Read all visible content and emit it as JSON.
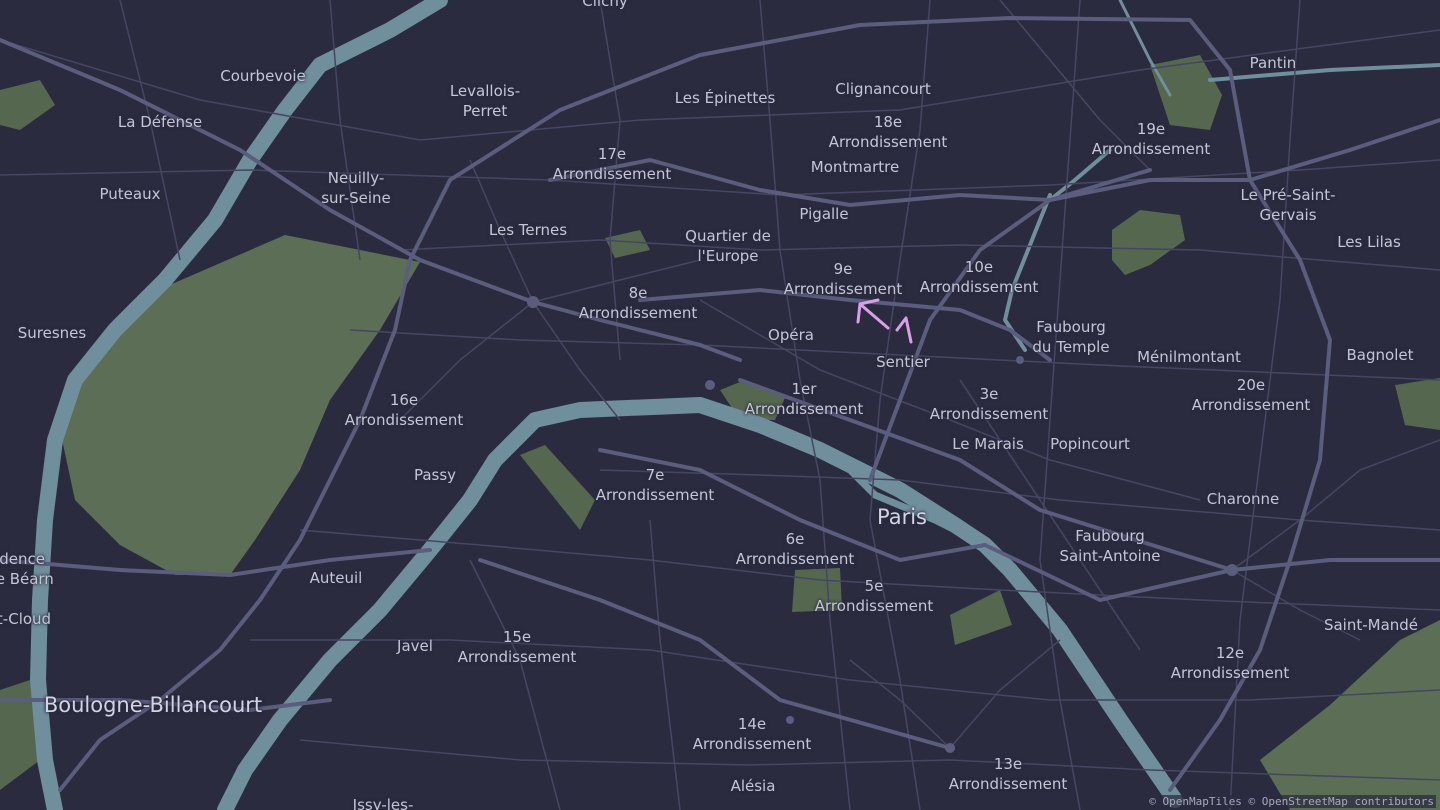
{
  "map": {
    "colors": {
      "background": "#2b2b40",
      "road": "#4a4c68",
      "major_road": "#5c5f7e",
      "water": "#6f8f9c",
      "park": "#5c6e55",
      "annotation": "#d9a0e8"
    },
    "labels": [
      {
        "id": "clichy",
        "text": "Clichy"
      },
      {
        "id": "courbevoie",
        "text": "Courbevoie"
      },
      {
        "id": "levallois",
        "text": "Levallois-\nPerret"
      },
      {
        "id": "les-epinettes",
        "text": "Les Épinettes"
      },
      {
        "id": "clignancourt",
        "text": "Clignancourt"
      },
      {
        "id": "pantin",
        "text": "Pantin"
      },
      {
        "id": "la-defense",
        "text": "La Défense"
      },
      {
        "id": "arr-18",
        "text": "18e\nArrondissement"
      },
      {
        "id": "arr-19",
        "text": "19e\nArrondissement"
      },
      {
        "id": "arr-17",
        "text": "17e\nArrondissement"
      },
      {
        "id": "montmartre",
        "text": "Montmartre"
      },
      {
        "id": "neuilly",
        "text": "Neuilly-\nsur-Seine"
      },
      {
        "id": "puteaux",
        "text": "Puteaux"
      },
      {
        "id": "le-pre-saint-gervais",
        "text": "Le Pré-Saint-\nGervais"
      },
      {
        "id": "pigalle",
        "text": "Pigalle"
      },
      {
        "id": "les-ternes",
        "text": "Les Ternes"
      },
      {
        "id": "quartier-europe",
        "text": "Quartier de\nl'Europe"
      },
      {
        "id": "les-lilas",
        "text": "Les Lilas"
      },
      {
        "id": "arr-9",
        "text": "9e\nArrondissement"
      },
      {
        "id": "arr-10",
        "text": "10e\nArrondissement"
      },
      {
        "id": "arr-8",
        "text": "8e\nArrondissement"
      },
      {
        "id": "suresnes",
        "text": "Suresnes"
      },
      {
        "id": "opera",
        "text": "Opéra"
      },
      {
        "id": "faubourg-temple",
        "text": "Faubourg\ndu Temple"
      },
      {
        "id": "menilmontant",
        "text": "Ménilmontant"
      },
      {
        "id": "bagnolet",
        "text": "Bagnolet"
      },
      {
        "id": "sentier",
        "text": "Sentier"
      },
      {
        "id": "arr-1",
        "text": "1er\nArrondissement"
      },
      {
        "id": "arr-3",
        "text": "3e\nArrondissement"
      },
      {
        "id": "arr-20",
        "text": "20e\nArrondissement"
      },
      {
        "id": "arr-16",
        "text": "16e\nArrondissement"
      },
      {
        "id": "le-marais",
        "text": "Le Marais"
      },
      {
        "id": "popincourt",
        "text": "Popincourt"
      },
      {
        "id": "passy",
        "text": "Passy"
      },
      {
        "id": "arr-7",
        "text": "7e\nArrondissement"
      },
      {
        "id": "charonne",
        "text": "Charonne"
      },
      {
        "id": "paris",
        "text": "Paris"
      },
      {
        "id": "residence-bearn",
        "text": "idence\nde Béarn"
      },
      {
        "id": "faubourg-st-antoine",
        "text": "Faubourg\nSaint-Antoine"
      },
      {
        "id": "arr-6",
        "text": "6e\nArrondissement"
      },
      {
        "id": "auteuil",
        "text": "Auteuil"
      },
      {
        "id": "arr-5",
        "text": "5e\nArrondissement"
      },
      {
        "id": "st-cloud",
        "text": "t-Cloud"
      },
      {
        "id": "saint-mande",
        "text": "Saint-Mandé"
      },
      {
        "id": "arr-15",
        "text": "15e\nArrondissement"
      },
      {
        "id": "javel",
        "text": "Javel"
      },
      {
        "id": "arr-12",
        "text": "12e\nArrondissement"
      },
      {
        "id": "boulogne",
        "text": "Boulogne-Billancourt"
      },
      {
        "id": "arr-14",
        "text": "14e\nArrondissement"
      },
      {
        "id": "arr-13",
        "text": "13e\nArrondissement"
      },
      {
        "id": "alesia",
        "text": "Alésia"
      },
      {
        "id": "issy",
        "text": "Issy-les-"
      }
    ],
    "attribution": "© OpenMapTiles © OpenStreetMap contributors"
  }
}
